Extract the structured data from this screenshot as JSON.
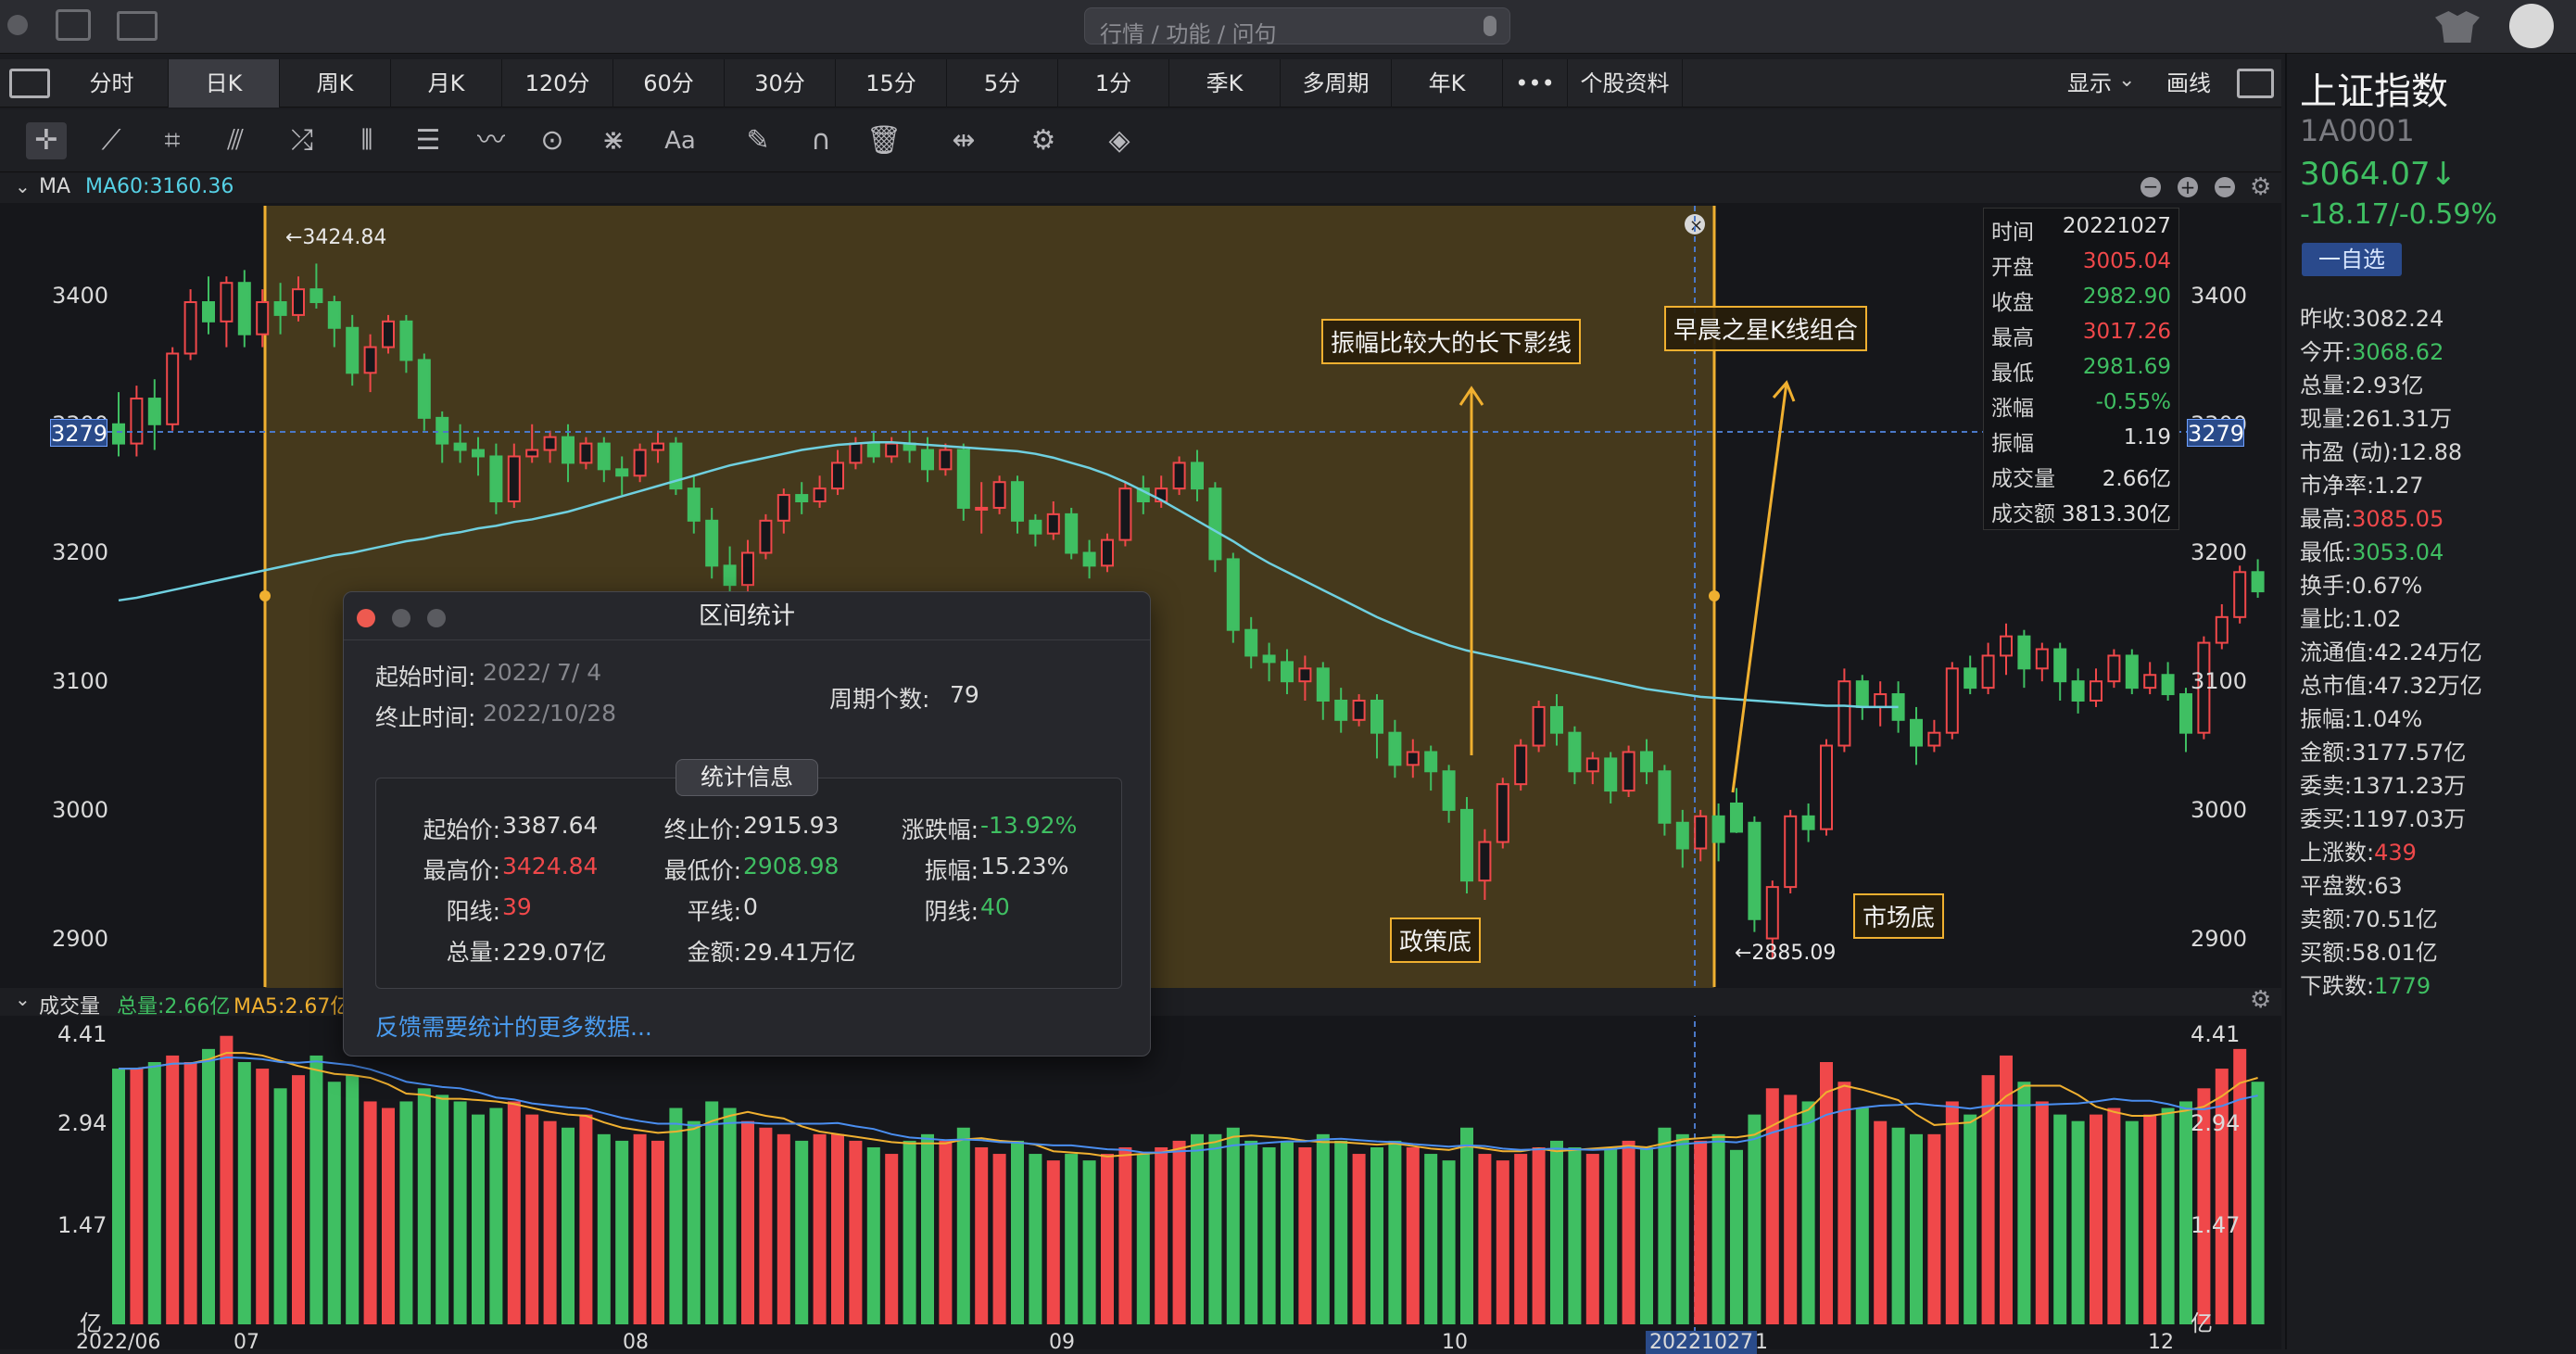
{
  "titlebar": {
    "search_placeholder": "行情 / 功能 / 问句"
  },
  "tabs": [
    "分时",
    "日K",
    "周K",
    "月K",
    "120分",
    "60分",
    "30分",
    "15分",
    "5分",
    "1分",
    "季K",
    "多周期",
    "年K",
    "•••",
    "个股资料"
  ],
  "active_tab": "日K",
  "tab_right": {
    "display": "显示",
    "draw": "画线"
  },
  "ma_header": {
    "label": "MA",
    "ma60": "MA60:3160.36"
  },
  "price_axis": [
    "3400",
    "3300",
    "3200",
    "3100",
    "3000",
    "2900"
  ],
  "crosshair_price": "3279",
  "vol_header": {
    "label": "成交量",
    "total": "总量:2.66亿",
    "ma5": "MA5:2.67亿"
  },
  "vol_axis": [
    "4.41",
    "2.94",
    "1.47",
    "亿"
  ],
  "date_axis": [
    "2022/06",
    "07",
    "08",
    "09",
    "10",
    "20221027",
    "1",
    "12"
  ],
  "high_marker": "←3424.84",
  "low_marker": "←2885.09",
  "annotations": {
    "long_shadow": "振幅比较大的长下影线",
    "morning_star": "早晨之星K线组合",
    "policy_bottom": "政策底",
    "market_bottom": "市场底"
  },
  "infobox": [
    {
      "k": "时间",
      "v": "20221027",
      "c": "#e0e0e0"
    },
    {
      "k": "开盘",
      "v": "3005.04",
      "c": "#f0484a"
    },
    {
      "k": "收盘",
      "v": "2982.90",
      "c": "#3fbf62"
    },
    {
      "k": "最高",
      "v": "3017.26",
      "c": "#f0484a"
    },
    {
      "k": "最低",
      "v": "2981.69",
      "c": "#3fbf62"
    },
    {
      "k": "涨幅",
      "v": "-0.55%",
      "c": "#3fbf62"
    },
    {
      "k": "振幅",
      "v": "1.19",
      "c": "#e0e0e0"
    },
    {
      "k": "成交量",
      "v": "2.66亿",
      "c": "#e0e0e0"
    },
    {
      "k": "成交额",
      "v": "3813.30亿",
      "c": "#e0e0e0"
    }
  ],
  "dialog": {
    "title": "区间统计",
    "start_label": "起始时间:",
    "start_value": "2022/ 7/ 4",
    "end_label": "终止时间:",
    "end_value": "2022/10/28",
    "period_label": "周期个数:",
    "period_value": "79",
    "stats_title": "统计信息",
    "stats": [
      {
        "k": "起始价:",
        "v": "3387.64",
        "c": ""
      },
      {
        "k": "终止价:",
        "v": "2915.93",
        "c": ""
      },
      {
        "k": "涨跌幅:",
        "v": "-13.92%",
        "c": "green"
      },
      {
        "k": "最高价:",
        "v": "3424.84",
        "c": "red"
      },
      {
        "k": "最低价:",
        "v": "2908.98",
        "c": "green"
      },
      {
        "k": "振幅:",
        "v": "15.23%",
        "c": ""
      },
      {
        "k": "阳线:",
        "v": "39",
        "c": "red"
      },
      {
        "k": "平线:",
        "v": "0",
        "c": ""
      },
      {
        "k": "阴线:",
        "v": "40",
        "c": "green"
      },
      {
        "k": "总量:",
        "v": "229.07亿",
        "c": ""
      },
      {
        "k": "金额:",
        "v": "29.41万亿",
        "c": ""
      }
    ],
    "feedback": "反馈需要统计的更多数据..."
  },
  "right_panel": {
    "name": "上证指数",
    "code": "1A0001",
    "price": "3064.07↓",
    "change": "-18.17/-0.59%",
    "watch_button": "一自选",
    "rows": [
      {
        "k": "昨收:",
        "v": "3082.24",
        "c": ""
      },
      {
        "k": "今开:",
        "v": "3068.62",
        "c": "green"
      },
      {
        "k": "总量:",
        "v": "2.93亿",
        "c": ""
      },
      {
        "k": "现量:",
        "v": "261.31万",
        "c": ""
      },
      {
        "k": "市盈 (动):",
        "v": "12.88",
        "c": ""
      },
      {
        "k": "市净率:",
        "v": "1.27",
        "c": ""
      },
      {
        "k": "最高:",
        "v": "3085.05",
        "c": "red"
      },
      {
        "k": "最低:",
        "v": "3053.04",
        "c": "green"
      },
      {
        "k": "换手:",
        "v": "0.67%",
        "c": ""
      },
      {
        "k": "量比:",
        "v": "1.02",
        "c": ""
      },
      {
        "k": "流通值:",
        "v": "42.24万亿",
        "c": ""
      },
      {
        "k": "总市值:",
        "v": "47.32万亿",
        "c": ""
      },
      {
        "k": "振幅:",
        "v": "1.04%",
        "c": ""
      },
      {
        "k": "金额:",
        "v": "3177.57亿",
        "c": ""
      },
      {
        "k": "委卖:",
        "v": "1371.23万",
        "c": ""
      },
      {
        "k": "委买:",
        "v": "1197.03万",
        "c": ""
      },
      {
        "k": "上涨数:",
        "v": "439",
        "c": "red"
      },
      {
        "k": "平盘数:",
        "v": "63",
        "c": ""
      },
      {
        "k": "卖额:",
        "v": "70.51亿",
        "c": ""
      },
      {
        "k": "买额:",
        "v": "58.01亿",
        "c": ""
      },
      {
        "k": "下跌数:",
        "v": "1779",
        "c": "green"
      }
    ]
  },
  "colors": {
    "up": "#f0484a",
    "down": "#3fbf62",
    "ma60": "#6fd0e0",
    "highlight": "#f0b030"
  },
  "chart_data": {
    "type": "candlestick",
    "price_range": [
      2855,
      3470
    ],
    "volume_range": [
      0,
      4.41
    ],
    "candles": [
      [
        3300,
        3285,
        3325,
        3275,
        3.9
      ],
      [
        3285,
        3320,
        3330,
        3275,
        3.9
      ],
      [
        3320,
        3300,
        3335,
        3280,
        4.0
      ],
      [
        3300,
        3355,
        3360,
        3295,
        4.1
      ],
      [
        3355,
        3395,
        3405,
        3350,
        4.0
      ],
      [
        3395,
        3380,
        3415,
        3370,
        4.2
      ],
      [
        3380,
        3410,
        3415,
        3360,
        4.4
      ],
      [
        3410,
        3370,
        3420,
        3360,
        4.0
      ],
      [
        3370,
        3395,
        3405,
        3360,
        3.9
      ],
      [
        3395,
        3385,
        3410,
        3370,
        3.6
      ],
      [
        3385,
        3405,
        3415,
        3380,
        3.8
      ],
      [
        3405,
        3395,
        3425,
        3390,
        4.1
      ],
      [
        3395,
        3375,
        3400,
        3360,
        3.7
      ],
      [
        3375,
        3340,
        3385,
        3330,
        3.8
      ],
      [
        3340,
        3360,
        3370,
        3325,
        3.4
      ],
      [
        3360,
        3380,
        3385,
        3355,
        3.3
      ],
      [
        3380,
        3350,
        3385,
        3340,
        3.4
      ],
      [
        3350,
        3305,
        3355,
        3295,
        3.6
      ],
      [
        3305,
        3285,
        3310,
        3270,
        3.5
      ],
      [
        3285,
        3280,
        3300,
        3270,
        3.4
      ],
      [
        3280,
        3275,
        3290,
        3260,
        3.2
      ],
      [
        3275,
        3240,
        3285,
        3230,
        3.3
      ],
      [
        3240,
        3275,
        3285,
        3235,
        3.4
      ],
      [
        3275,
        3280,
        3300,
        3270,
        3.2
      ],
      [
        3280,
        3290,
        3295,
        3270,
        3.1
      ],
      [
        3290,
        3270,
        3300,
        3255,
        3.0
      ],
      [
        3270,
        3285,
        3290,
        3265,
        3.2
      ],
      [
        3285,
        3265,
        3290,
        3255,
        2.9
      ],
      [
        3265,
        3260,
        3275,
        3245,
        2.8
      ],
      [
        3260,
        3280,
        3285,
        3255,
        2.9
      ],
      [
        3280,
        3285,
        3295,
        3270,
        2.8
      ],
      [
        3285,
        3250,
        3290,
        3245,
        3.3
      ],
      [
        3250,
        3225,
        3260,
        3215,
        3.1
      ],
      [
        3225,
        3190,
        3235,
        3180,
        3.4
      ],
      [
        3190,
        3175,
        3205,
        3170,
        3.3
      ],
      [
        3175,
        3200,
        3210,
        3170,
        3.1
      ],
      [
        3200,
        3225,
        3230,
        3195,
        3.0
      ],
      [
        3225,
        3245,
        3250,
        3215,
        2.9
      ],
      [
        3245,
        3240,
        3255,
        3230,
        2.8
      ],
      [
        3240,
        3250,
        3260,
        3235,
        2.9
      ],
      [
        3250,
        3270,
        3280,
        3245,
        2.9
      ],
      [
        3270,
        3285,
        3290,
        3265,
        2.8
      ],
      [
        3285,
        3275,
        3295,
        3270,
        2.7
      ],
      [
        3275,
        3285,
        3290,
        3270,
        2.6
      ],
      [
        3285,
        3280,
        3295,
        3270,
        2.8
      ],
      [
        3280,
        3265,
        3290,
        3255,
        2.9
      ],
      [
        3265,
        3280,
        3285,
        3260,
        2.8
      ],
      [
        3280,
        3235,
        3285,
        3225,
        3.0
      ],
      [
        3235,
        3235,
        3255,
        3215,
        2.7
      ],
      [
        3235,
        3255,
        3260,
        3230,
        2.6
      ],
      [
        3255,
        3225,
        3260,
        3215,
        2.8
      ],
      [
        3225,
        3215,
        3230,
        3205,
        2.6
      ],
      [
        3215,
        3230,
        3240,
        3210,
        2.5
      ],
      [
        3230,
        3200,
        3235,
        3195,
        2.6
      ],
      [
        3200,
        3190,
        3210,
        3180,
        2.5
      ],
      [
        3190,
        3210,
        3215,
        3185,
        2.6
      ],
      [
        3210,
        3250,
        3255,
        3205,
        2.7
      ],
      [
        3250,
        3240,
        3260,
        3230,
        2.6
      ],
      [
        3240,
        3250,
        3260,
        3235,
        2.7
      ],
      [
        3250,
        3270,
        3275,
        3245,
        2.8
      ],
      [
        3270,
        3250,
        3280,
        3240,
        2.9
      ],
      [
        3250,
        3195,
        3255,
        3185,
        2.9
      ],
      [
        3195,
        3140,
        3200,
        3130,
        3.0
      ],
      [
        3140,
        3120,
        3150,
        3110,
        2.8
      ],
      [
        3120,
        3115,
        3130,
        3100,
        2.7
      ],
      [
        3115,
        3100,
        3125,
        3090,
        2.8
      ],
      [
        3100,
        3110,
        3120,
        3085,
        2.7
      ],
      [
        3110,
        3085,
        3115,
        3070,
        2.9
      ],
      [
        3085,
        3070,
        3095,
        3060,
        2.8
      ],
      [
        3070,
        3085,
        3090,
        3065,
        2.6
      ],
      [
        3085,
        3060,
        3090,
        3040,
        2.7
      ],
      [
        3060,
        3035,
        3070,
        3025,
        2.8
      ],
      [
        3035,
        3045,
        3055,
        3025,
        2.7
      ],
      [
        3045,
        3030,
        3050,
        3015,
        2.6
      ],
      [
        3030,
        3000,
        3035,
        2990,
        2.5
      ],
      [
        3000,
        2945,
        3010,
        2935,
        3.0
      ],
      [
        2945,
        2975,
        2985,
        2930,
        2.6
      ],
      [
        2975,
        3020,
        3025,
        2970,
        2.5
      ],
      [
        3020,
        3050,
        3055,
        3015,
        2.6
      ],
      [
        3050,
        3080,
        3085,
        3045,
        2.7
      ],
      [
        3080,
        3060,
        3090,
        3050,
        2.8
      ],
      [
        3060,
        3030,
        3065,
        3020,
        2.7
      ],
      [
        3030,
        3040,
        3045,
        3020,
        2.6
      ],
      [
        3040,
        3015,
        3045,
        3005,
        2.7
      ],
      [
        3015,
        3045,
        3050,
        3010,
        2.8
      ],
      [
        3045,
        3030,
        3055,
        3020,
        2.7
      ],
      [
        3030,
        2990,
        3035,
        2980,
        3.0
      ],
      [
        2990,
        2970,
        3000,
        2955,
        2.9
      ],
      [
        2970,
        2995,
        3000,
        2960,
        2.8
      ],
      [
        2995,
        2975,
        3005,
        2960,
        2.9
      ],
      [
        3005,
        2983,
        3017,
        2982,
        2.66
      ],
      [
        2990,
        2915,
        2995,
        2905,
        3.2
      ],
      [
        2900,
        2940,
        2945,
        2885,
        3.6
      ],
      [
        2940,
        2995,
        3000,
        2935,
        3.5
      ],
      [
        2995,
        2985,
        3005,
        2975,
        3.4
      ],
      [
        2985,
        3050,
        3055,
        2980,
        4.0
      ],
      [
        3050,
        3100,
        3110,
        3045,
        3.7
      ],
      [
        3100,
        3080,
        3105,
        3070,
        3.3
      ],
      [
        3080,
        3090,
        3100,
        3065,
        3.1
      ],
      [
        3090,
        3070,
        3100,
        3060,
        3.0
      ],
      [
        3070,
        3050,
        3080,
        3035,
        2.9
      ],
      [
        3050,
        3060,
        3070,
        3045,
        2.9
      ],
      [
        3060,
        3110,
        3115,
        3055,
        3.4
      ],
      [
        3110,
        3095,
        3120,
        3090,
        3.2
      ],
      [
        3095,
        3120,
        3130,
        3090,
        3.8
      ],
      [
        3120,
        3135,
        3145,
        3105,
        4.1
      ],
      [
        3135,
        3110,
        3140,
        3095,
        3.7
      ],
      [
        3110,
        3125,
        3130,
        3100,
        3.4
      ],
      [
        3125,
        3100,
        3130,
        3085,
        3.2
      ],
      [
        3100,
        3085,
        3110,
        3075,
        3.1
      ],
      [
        3085,
        3100,
        3110,
        3080,
        3.2
      ],
      [
        3100,
        3120,
        3125,
        3095,
        3.3
      ],
      [
        3120,
        3095,
        3125,
        3090,
        3.1
      ],
      [
        3095,
        3105,
        3115,
        3090,
        3.2
      ],
      [
        3105,
        3090,
        3115,
        3085,
        3.3
      ],
      [
        3090,
        3060,
        3095,
        3045,
        3.4
      ],
      [
        3060,
        3130,
        3135,
        3055,
        3.6
      ],
      [
        3130,
        3150,
        3160,
        3125,
        3.9
      ],
      [
        3150,
        3185,
        3190,
        3145,
        4.2
      ],
      [
        3185,
        3170,
        3195,
        3165,
        3.7
      ]
    ],
    "ma60": [
      3163,
      3165,
      3168,
      3171,
      3174,
      3177,
      3180,
      3183,
      3186,
      3189,
      3192,
      3195,
      3198,
      3200,
      3203,
      3206,
      3209,
      3211,
      3214,
      3216,
      3219,
      3221,
      3224,
      3226,
      3229,
      3232,
      3236,
      3240,
      3244,
      3248,
      3252,
      3256,
      3260,
      3264,
      3268,
      3271,
      3274,
      3277,
      3280,
      3282,
      3284,
      3285,
      3286,
      3286,
      3285,
      3284,
      3283,
      3282,
      3281,
      3280,
      3279,
      3277,
      3274,
      3270,
      3266,
      3261,
      3255,
      3248,
      3241,
      3233,
      3225,
      3217,
      3209,
      3200,
      3192,
      3185,
      3178,
      3171,
      3164,
      3157,
      3150,
      3144,
      3138,
      3133,
      3128,
      3124,
      3121,
      3118,
      3115,
      3112,
      3109,
      3106,
      3103,
      3100,
      3097,
      3094,
      3092,
      3090,
      3088,
      3087,
      3086,
      3085,
      3084,
      3083,
      3082,
      3081,
      3081,
      3080,
      3080,
      3080
    ]
  }
}
